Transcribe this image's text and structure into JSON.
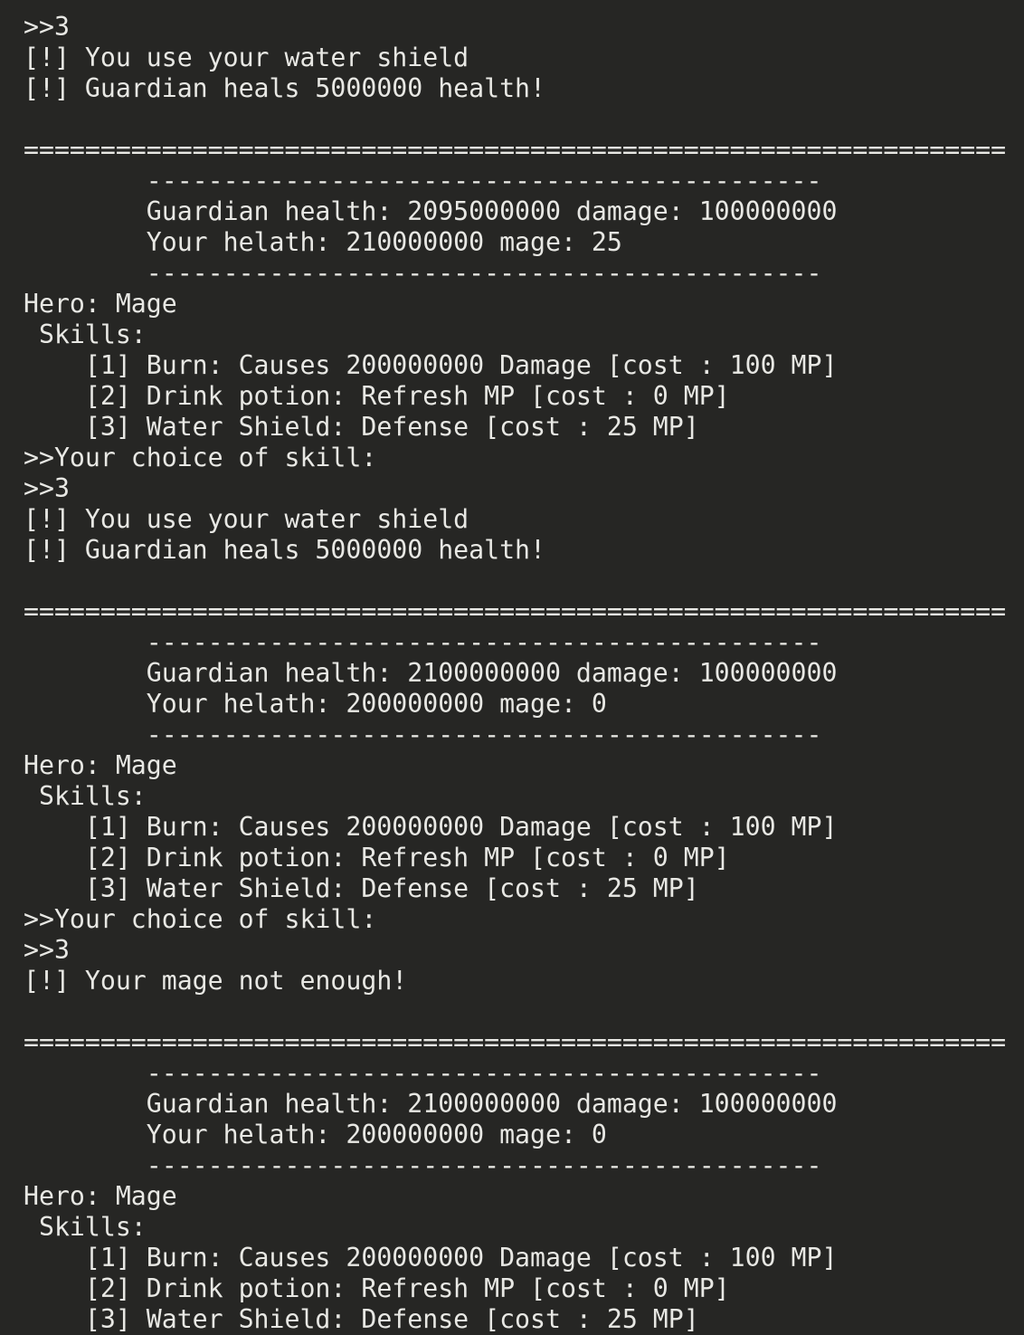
{
  "terminal": {
    "lines": [
      ">>3",
      "[!] You use your water shield",
      "[!] Guardian heals 5000000 health!",
      "",
      "================================================================",
      "        --------------------------------------------",
      "        Guardian health: 2095000000 damage: 100000000",
      "        Your helath: 210000000 mage: 25",
      "        --------------------------------------------",
      "Hero: Mage",
      " Skills:",
      "    [1] Burn: Causes 200000000 Damage [cost : 100 MP]",
      "    [2] Drink potion: Refresh MP [cost : 0 MP]",
      "    [3] Water Shield: Defense [cost : 25 MP]",
      ">>Your choice of skill:",
      ">>3",
      "[!] You use your water shield",
      "[!] Guardian heals 5000000 health!",
      "",
      "================================================================",
      "        --------------------------------------------",
      "        Guardian health: 2100000000 damage: 100000000",
      "        Your helath: 200000000 mage: 0",
      "        --------------------------------------------",
      "Hero: Mage",
      " Skills:",
      "    [1] Burn: Causes 200000000 Damage [cost : 100 MP]",
      "    [2] Drink potion: Refresh MP [cost : 0 MP]",
      "    [3] Water Shield: Defense [cost : 25 MP]",
      ">>Your choice of skill:",
      ">>3",
      "[!] Your mage not enough!",
      "",
      "================================================================",
      "        --------------------------------------------",
      "        Guardian health: 2100000000 damage: 100000000",
      "        Your helath: 200000000 mage: 0",
      "        --------------------------------------------",
      "Hero: Mage",
      " Skills:",
      "    [1] Burn: Causes 200000000 Damage [cost : 100 MP]",
      "    [2] Drink potion: Refresh MP [cost : 0 MP]",
      "    [3] Water Shield: Defense [cost : 25 MP]"
    ]
  },
  "colors": {
    "background": "#262624",
    "foreground": "#e8e8e4"
  }
}
